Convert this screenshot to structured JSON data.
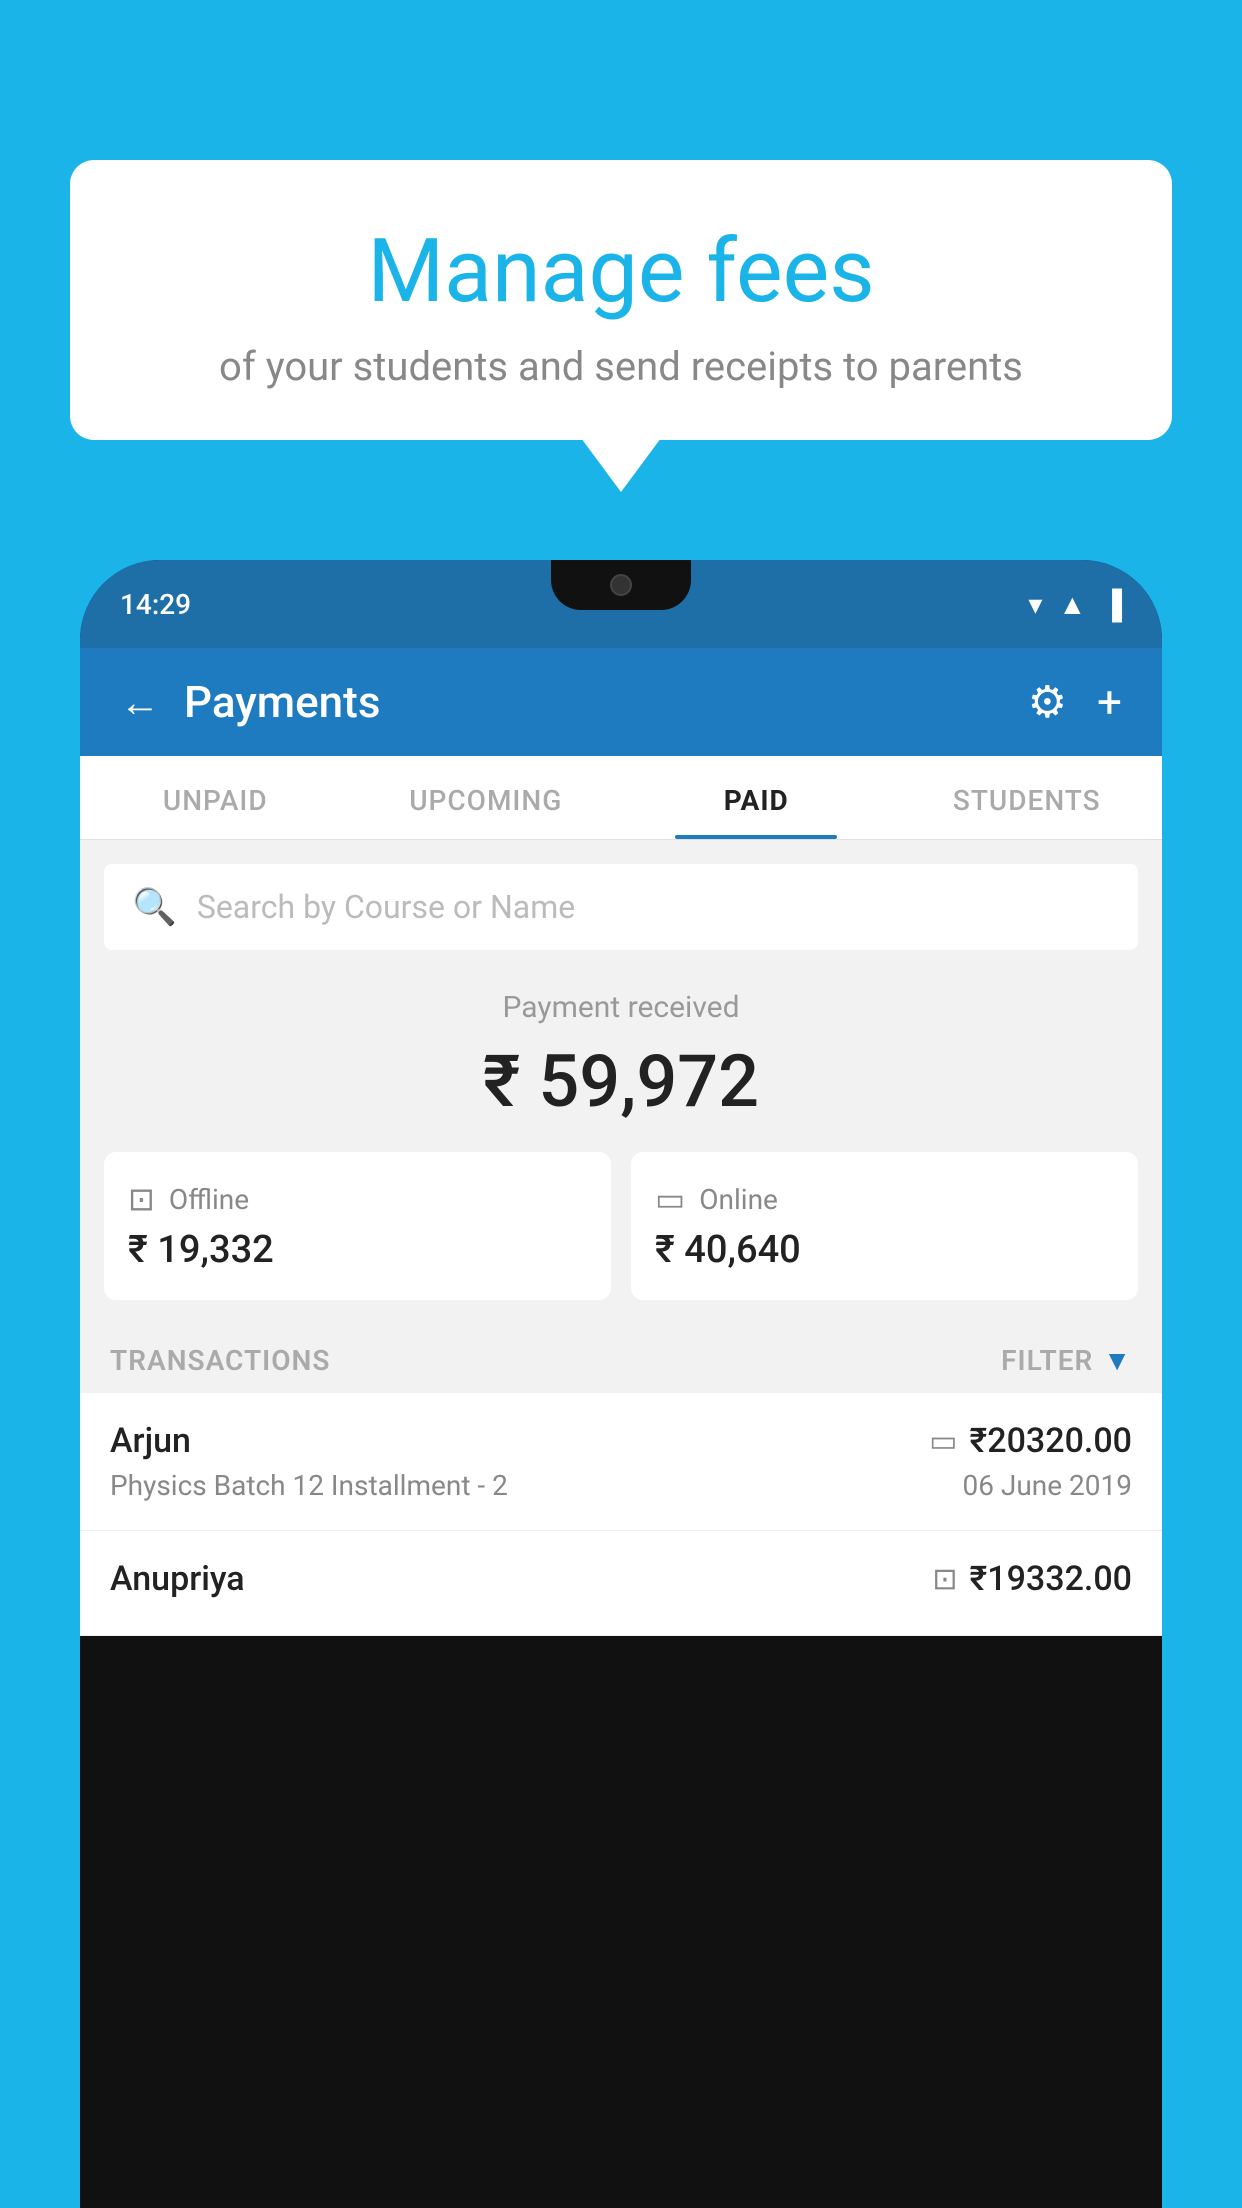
{
  "background": {
    "color": "#1ab4e8"
  },
  "speech_bubble": {
    "heading": "Manage fees",
    "subtext": "of your students and send receipts to parents"
  },
  "phone": {
    "status_bar": {
      "time": "14:29"
    },
    "header": {
      "title": "Payments",
      "back_label": "←",
      "gear_label": "⚙",
      "plus_label": "+"
    },
    "tabs": [
      {
        "label": "UNPAID",
        "active": false
      },
      {
        "label": "UPCOMING",
        "active": false
      },
      {
        "label": "PAID",
        "active": true
      },
      {
        "label": "STUDENTS",
        "active": false
      }
    ],
    "search": {
      "placeholder": "Search by Course or Name"
    },
    "payment_summary": {
      "label": "Payment received",
      "amount": "₹ 59,972",
      "offline_label": "Offline",
      "offline_amount": "₹ 19,332",
      "online_label": "Online",
      "online_amount": "₹ 40,640"
    },
    "transactions_section": {
      "label": "TRANSACTIONS",
      "filter_label": "FILTER"
    },
    "transactions": [
      {
        "name": "Arjun",
        "course": "Physics Batch 12 Installment - 2",
        "amount": "₹20320.00",
        "date": "06 June 2019",
        "payment_type": "online"
      },
      {
        "name": "Anupriya",
        "course": "",
        "amount": "₹19332.00",
        "date": "",
        "payment_type": "offline"
      }
    ]
  }
}
